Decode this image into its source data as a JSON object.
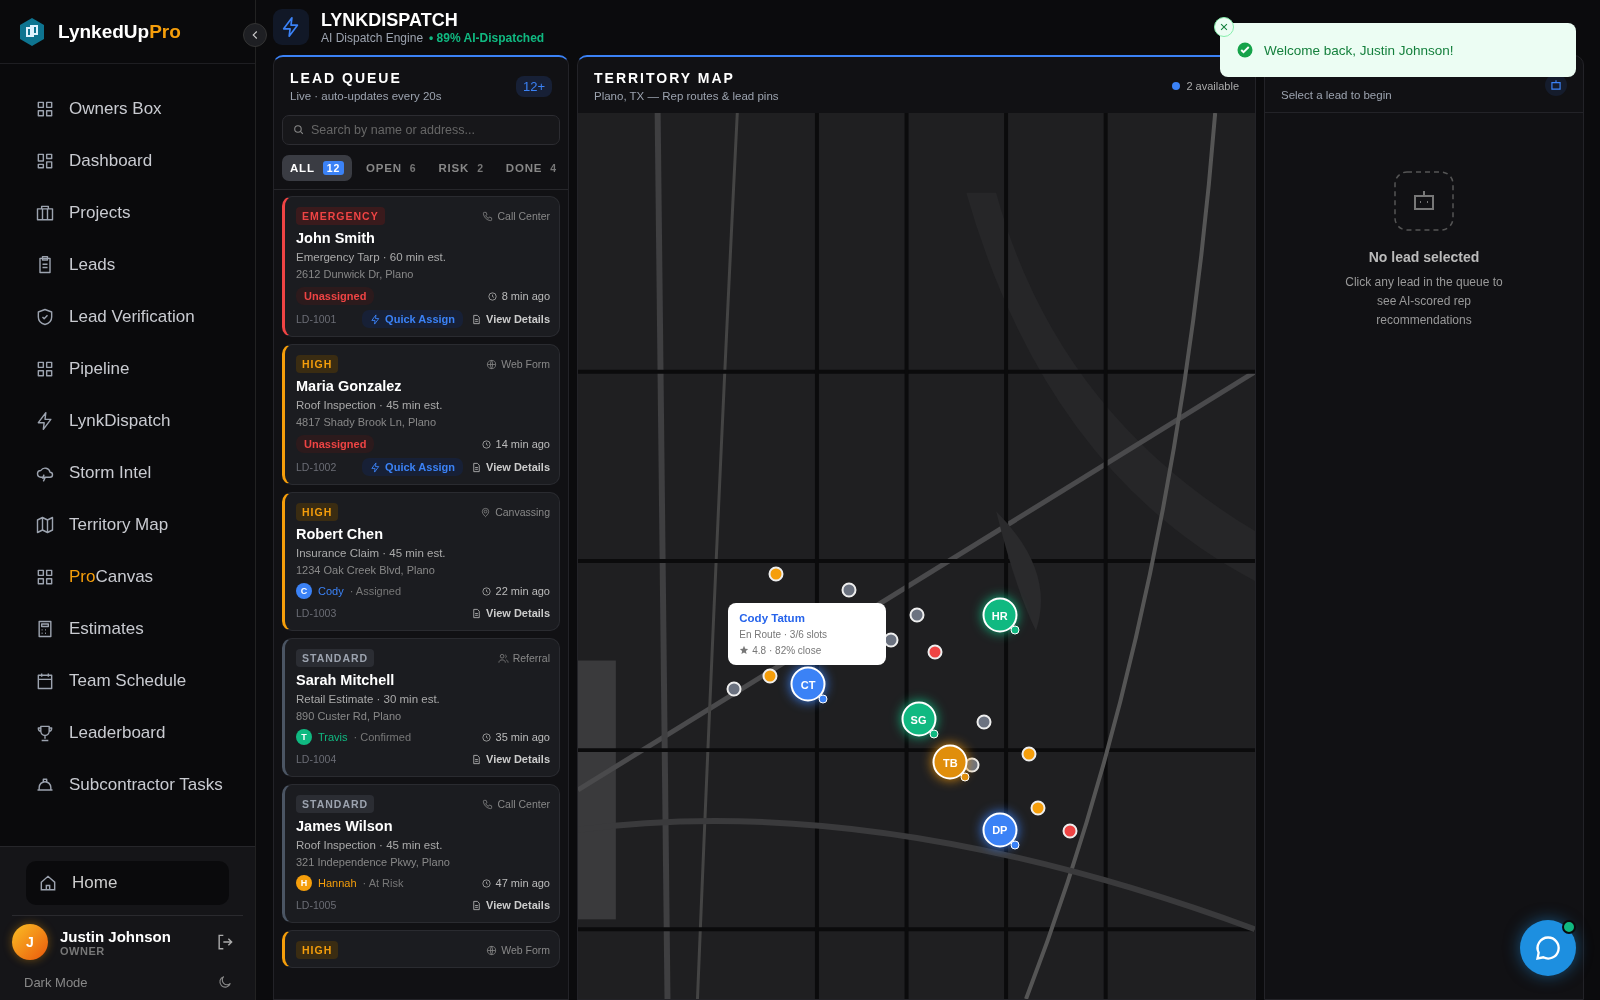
{
  "brand": {
    "name": "LynkedUp",
    "accent": "Pro"
  },
  "nav": [
    {
      "label": "Owners Box"
    },
    {
      "label": "Dashboard"
    },
    {
      "label": "Projects"
    },
    {
      "label": "Leads"
    },
    {
      "label": "Lead Verification"
    },
    {
      "label": "Pipeline"
    },
    {
      "label": "LynkDispatch"
    },
    {
      "label": "Storm Intel"
    },
    {
      "label": "Territory Map"
    },
    {
      "label": "Canvas",
      "accent": "Pro"
    },
    {
      "label": "Estimates"
    },
    {
      "label": "Team Schedule"
    },
    {
      "label": "Leaderboard"
    },
    {
      "label": "Subcontractor Tasks"
    }
  ],
  "home": {
    "label": "Home"
  },
  "user": {
    "initial": "J",
    "name": "Justin Johnson",
    "role": "OWNER"
  },
  "dark_mode": {
    "label": "Dark Mode"
  },
  "header": {
    "title": "LYNKDISPATCH",
    "subtitle": "AI Dispatch Engine",
    "stat": "• 89% AI-Dispatched"
  },
  "toast": {
    "message": "Welcome back, Justin Johnson!"
  },
  "queue": {
    "title": "LEAD QUEUE",
    "subtitle": "Live · auto-updates every 20s",
    "badge": "12+",
    "search": {
      "placeholder": "Search by name or address..."
    },
    "tabs": [
      {
        "label": "ALL",
        "count": "12",
        "selected": true
      },
      {
        "label": "OPEN",
        "count": "6",
        "selected": false
      },
      {
        "label": "RISK",
        "count": "2",
        "selected": false
      },
      {
        "label": "DONE",
        "count": "4",
        "selected": false
      }
    ],
    "leads": [
      {
        "kind": "emergency",
        "tag": "EMERGENCY",
        "source": {
          "kind": "phone",
          "label": "Call Center"
        },
        "name": "John Smith",
        "service": "Emergency Tarp · 60 min est.",
        "address": "2612 Dunwick Dr, Plano",
        "assignment": {
          "kind": "unassigned",
          "label": "Unassigned"
        },
        "time": "8 min ago",
        "id": "LD-1001",
        "quick_assign": "Quick Assign",
        "details": "View Details"
      },
      {
        "kind": "high",
        "tag": "HIGH",
        "source": {
          "kind": "globe",
          "label": "Web Form"
        },
        "name": "Maria Gonzalez",
        "service": "Roof Inspection · 45 min est.",
        "address": "4817 Shady Brook Ln, Plano",
        "assignment": {
          "kind": "unassigned",
          "label": "Unassigned"
        },
        "time": "14 min ago",
        "id": "LD-1002",
        "quick_assign": "Quick Assign",
        "details": "View Details"
      },
      {
        "kind": "high",
        "tag": "HIGH",
        "source": {
          "kind": "pin",
          "label": "Canvassing"
        },
        "name": "Robert Chen",
        "service": "Insurance Claim · 45 min est.",
        "address": "1234 Oak Creek Blvd, Plano",
        "assignment": {
          "kind": "rep",
          "initial": "C",
          "rep": "Cody",
          "status": "· Assigned",
          "color": "#3b82f6"
        },
        "time": "22 min ago",
        "id": "LD-1003",
        "details": "View Details"
      },
      {
        "kind": "standard",
        "tag": "STANDARD",
        "source": {
          "kind": "people",
          "label": "Referral"
        },
        "name": "Sarah Mitchell",
        "service": "Retail Estimate · 30 min est.",
        "address": "890 Custer Rd, Plano",
        "assignment": {
          "kind": "rep",
          "initial": "T",
          "rep": "Travis",
          "status": "· Confirmed",
          "color": "#10b981"
        },
        "time": "35 min ago",
        "id": "LD-1004",
        "details": "View Details"
      },
      {
        "kind": "standard",
        "tag": "STANDARD",
        "source": {
          "kind": "phone",
          "label": "Call Center"
        },
        "name": "James Wilson",
        "service": "Roof Inspection · 45 min est.",
        "address": "321 Independence Pkwy, Plano",
        "assignment": {
          "kind": "rep",
          "initial": "H",
          "rep": "Hannah",
          "status": "· At Risk",
          "color": "#f59e0b"
        },
        "time": "47 min ago",
        "id": "LD-1005",
        "details": "View Details"
      },
      {
        "kind": "high",
        "tag": "HIGH",
        "source": {
          "kind": "globe",
          "label": "Web Form"
        }
      }
    ]
  },
  "map": {
    "title": "TERRITORY MAP",
    "subtitle": "Plano, TX — Rep routes & lead pins",
    "available": "2 available",
    "lead_pins": [
      {
        "color": "#f59e0b"
      },
      {
        "color": "#6b7280"
      },
      {
        "color": "#6b7280"
      },
      {
        "color": "#6b7280"
      },
      {
        "color": "#ef4444"
      },
      {
        "color": "#f59e0b"
      },
      {
        "color": "#6b7280"
      },
      {
        "color": "#6b7280"
      },
      {
        "color": "#6b7280"
      },
      {
        "color": "#f59e0b"
      },
      {
        "color": "#f59e0b"
      },
      {
        "color": "#ef4444"
      }
    ],
    "reps": [
      {
        "initials": "HR",
        "color": "#10b981"
      },
      {
        "initials": "CT",
        "color": "#3b82f6"
      },
      {
        "initials": "SG",
        "color": "#10b981"
      },
      {
        "initials": "TB",
        "color": "#e08e0b"
      },
      {
        "initials": "DP",
        "color": "#3b82f6"
      }
    ],
    "tooltip": {
      "name": "Cody Tatum",
      "status": "En Route · 3/6 slots",
      "rating": "4.8 · 82% close"
    }
  },
  "recommendations": {
    "subtitle": "Select a lead to begin",
    "empty_title": "No lead selected",
    "empty_text": "Click any lead in the queue to see AI-scored rep recommendations"
  }
}
